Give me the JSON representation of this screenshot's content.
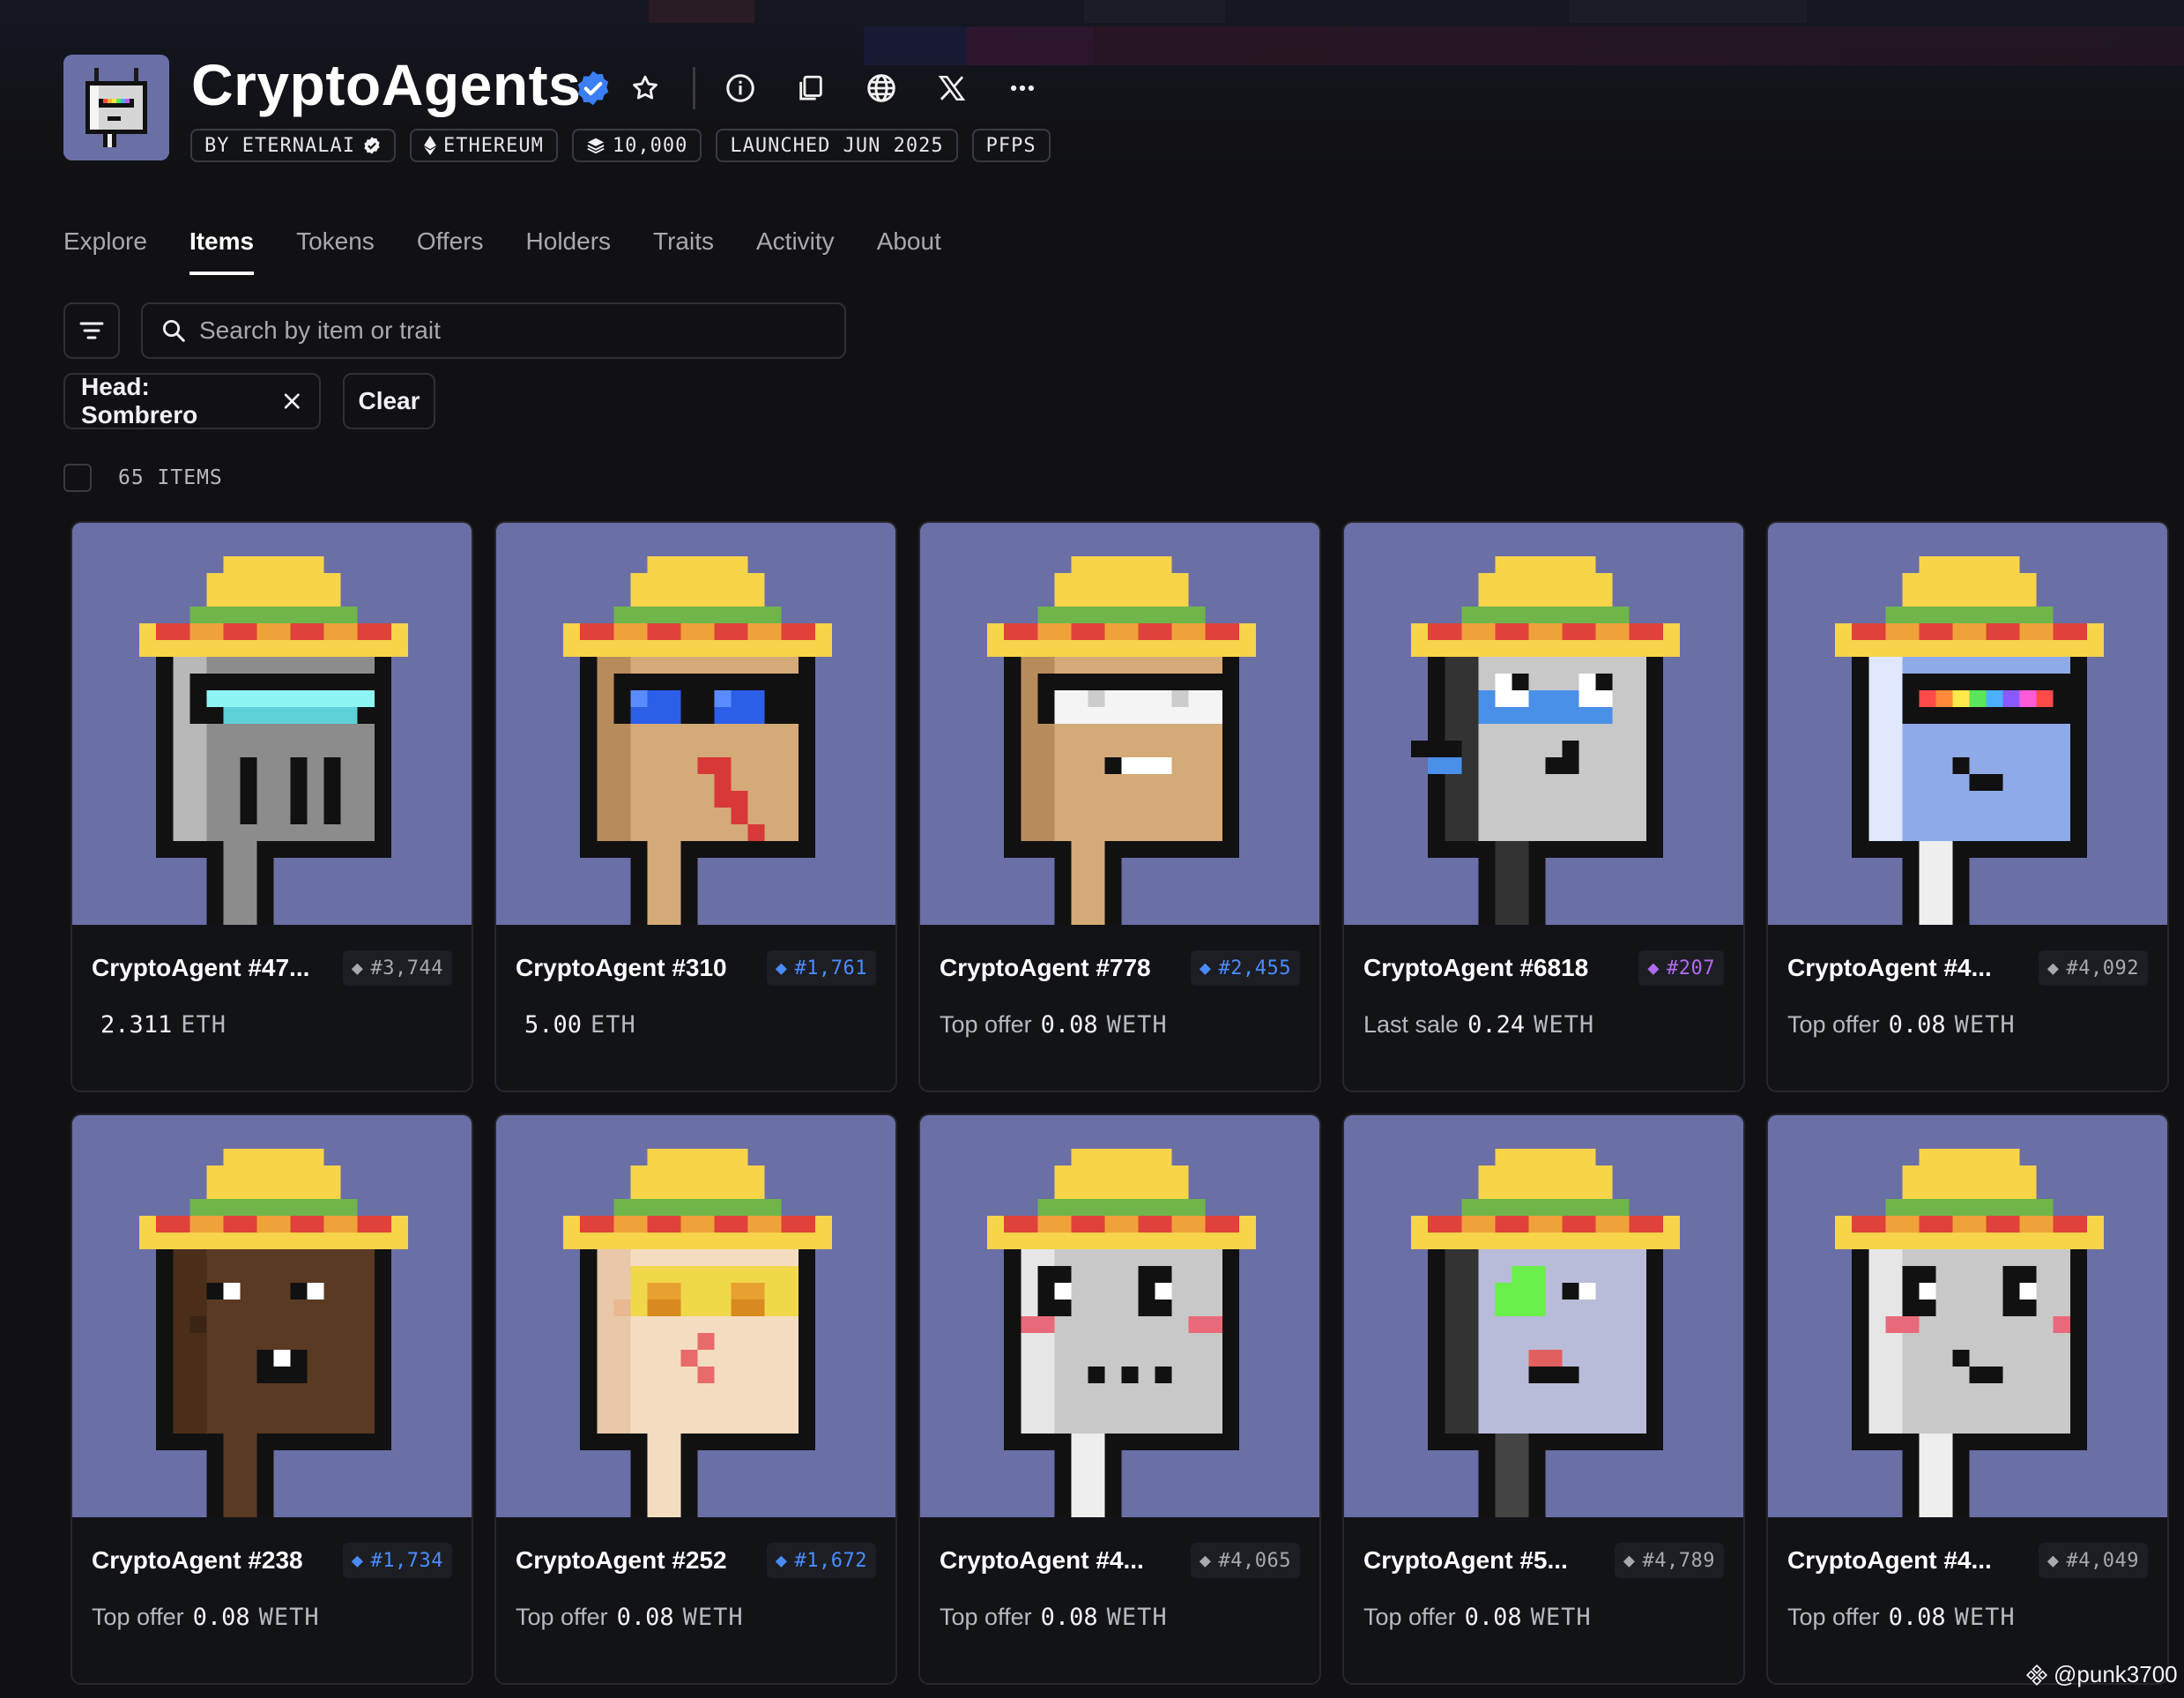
{
  "colors": {
    "accent_blue": "#3b7ff5",
    "rank_gold": "#a8a9ae",
    "rank_purple": "#b06cf0",
    "art_bg": "#6a6fa6"
  },
  "header": {
    "title": "CryptoAgents",
    "chips": {
      "creator": "BY ETERNALAI",
      "chain": "ETHEREUM",
      "supply": "10,000",
      "launched": "LAUNCHED JUN 2025",
      "category": "PFPS"
    }
  },
  "tabs": [
    "Explore",
    "Items",
    "Tokens",
    "Offers",
    "Holders",
    "Traits",
    "Activity",
    "About"
  ],
  "search": {
    "placeholder": "Search by item or trait"
  },
  "filters": {
    "active": "Head: Sombrero",
    "clear_label": "Clear"
  },
  "count": "65 ITEMS",
  "items": [
    {
      "name": "CryptoAgent #47...",
      "rank": "#3,744",
      "rank_tier": "gray",
      "price_label": "",
      "price": "2.311",
      "currency": "ETH",
      "art": "cyan-shades-gray"
    },
    {
      "name": "CryptoAgent #310",
      "rank": "#1,761",
      "rank_tier": "blue",
      "price_label": "",
      "price": "5.00",
      "currency": "ETH",
      "art": "blue-shades-tan"
    },
    {
      "name": "CryptoAgent #778",
      "rank": "#2,455",
      "rank_tier": "blue",
      "price_label": "Top offer",
      "price": "0.08",
      "currency": "WETH",
      "art": "white-shades-tan"
    },
    {
      "name": "CryptoAgent #6818",
      "rank": "#207",
      "rank_tier": "purple",
      "price_label": "Last sale",
      "price": "0.24",
      "currency": "WETH",
      "art": "robot-gray-blue"
    },
    {
      "name": "CryptoAgent #4...",
      "rank": "#4,092",
      "rank_tier": "gray",
      "price_label": "Top offer",
      "price": "0.08",
      "currency": "WETH",
      "art": "rainbow-visor"
    },
    {
      "name": "CryptoAgent #238",
      "rank": "#1,734",
      "rank_tier": "blue",
      "price_label": "Top offer",
      "price": "0.08",
      "currency": "WETH",
      "art": "dark-skin"
    },
    {
      "name": "CryptoAgent #252",
      "rank": "#1,672",
      "rank_tier": "blue",
      "price_label": "Top offer",
      "price": "0.08",
      "currency": "WETH",
      "art": "yellow-shades-pale"
    },
    {
      "name": "CryptoAgent #4...",
      "rank": "#4,065",
      "rank_tier": "gray",
      "price_label": "Top offer",
      "price": "0.08",
      "currency": "WETH",
      "art": "gray-blush"
    },
    {
      "name": "CryptoAgent #5...",
      "rank": "#4,789",
      "rank_tier": "gray",
      "price_label": "Top offer",
      "price": "0.08",
      "currency": "WETH",
      "art": "green-eye"
    },
    {
      "name": "CryptoAgent #4...",
      "rank": "#4,049",
      "rank_tier": "gray",
      "price_label": "Top offer",
      "price": "0.08",
      "currency": "WETH",
      "art": "gray-blush-2"
    }
  ],
  "watermark": "@punk3700"
}
